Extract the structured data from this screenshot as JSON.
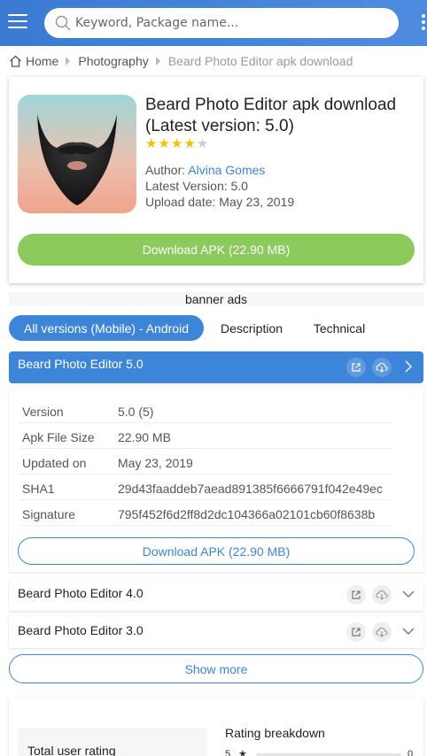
{
  "header": {
    "search_placeholder": "Keyword, Package name..."
  },
  "breadcrumb": {
    "home": "Home",
    "category": "Photography",
    "current": "Beard Photo Editor apk download"
  },
  "app": {
    "title": "Beard Photo Editor apk download (Latest version: 5.0)",
    "rating": 4,
    "rating_max": 5,
    "author_label": "Author:",
    "author": "Alvina Gomes",
    "latest_version": "Latest Version: 5.0",
    "upload_date": "Upload date: May 23, 2019",
    "download_label": "Download APK (22.90 MB)"
  },
  "banner": "banner ads",
  "tabs": [
    {
      "label": "All versions (Mobile) - Android"
    },
    {
      "label": "Description"
    },
    {
      "label": "Technical"
    }
  ],
  "current_version": {
    "title": "Beard Photo Editor 5.0",
    "details": [
      {
        "key": "Version",
        "value": "5.0 (5)"
      },
      {
        "key": "Apk File Size",
        "value": "22.90 MB"
      },
      {
        "key": "Updated on",
        "value": "May 23, 2019"
      },
      {
        "key": "SHA1",
        "value": "29d43faaddeb7aead891385f6666791f042e49ec"
      },
      {
        "key": "Signature",
        "value": "795f452f6d2ff8d2dc104366a02101cb60f8638b"
      }
    ],
    "download_label": "Download APK (22.90 MB)"
  },
  "other_versions": [
    {
      "title": "Beard Photo Editor 4.0"
    },
    {
      "title": "Beard Photo Editor 3.0"
    }
  ],
  "show_more": "Show more",
  "rating_section": {
    "total_label": "Total user rating",
    "breakdown_title": "Rating breakdown",
    "rows": [
      {
        "stars": "5",
        "count": "0",
        "fraction": 0
      }
    ]
  },
  "colors": {
    "accent": "#3d85d8",
    "download_green": "#8cca5e",
    "star": "#f2c200"
  }
}
